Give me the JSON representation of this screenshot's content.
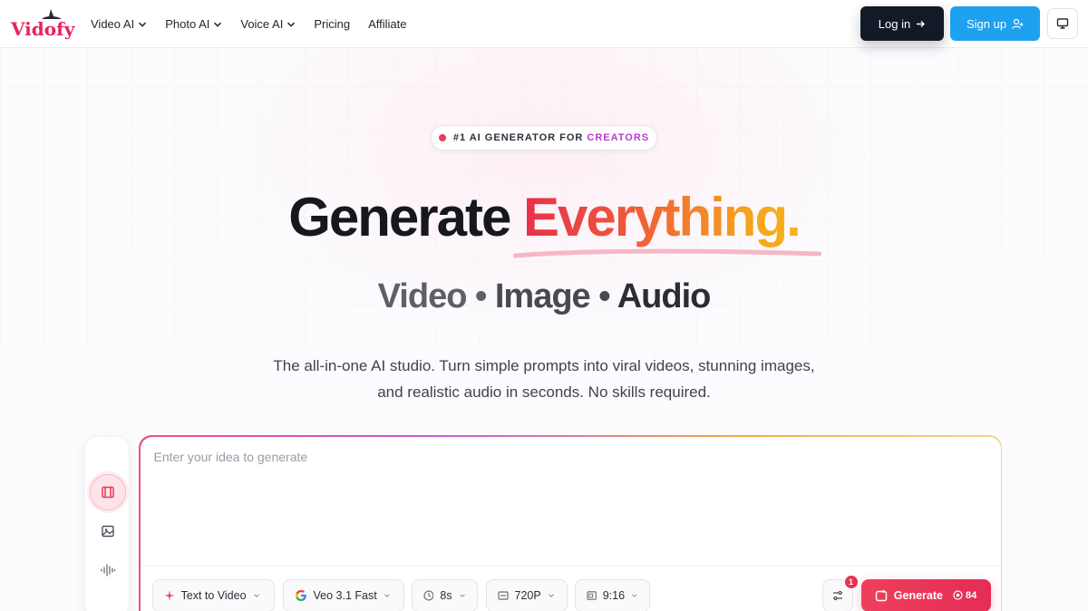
{
  "brand": {
    "name": "Vidofy"
  },
  "nav": {
    "items": [
      {
        "label": "Video AI",
        "dropdown": true
      },
      {
        "label": "Photo AI",
        "dropdown": true
      },
      {
        "label": "Voice AI",
        "dropdown": true
      },
      {
        "label": "Pricing",
        "dropdown": false
      },
      {
        "label": "Affiliate",
        "dropdown": false
      }
    ],
    "login_label": "Log in",
    "signup_label": "Sign up"
  },
  "hero": {
    "badge_text": "#1 AI GENERATOR FOR",
    "badge_accent": "CREATORS",
    "headline_part1": "Generate",
    "headline_part2": "Everything.",
    "subhead_1": "Video",
    "subhead_2": "Image",
    "subhead_3": "Audio",
    "subhead_sep": "•",
    "description": "The all-in-one AI studio. Turn simple prompts into viral videos, stunning images, and realistic audio in seconds. No skills required."
  },
  "prompt": {
    "placeholder": "Enter your idea to generate",
    "value": ""
  },
  "toolbar": {
    "mode_label": "Text to Video",
    "model_label": "Veo 3.1 Fast",
    "duration_label": "8s",
    "resolution_label": "720P",
    "ratio_label": "9:16",
    "settings_badge": "1",
    "generate_label": "Generate",
    "generate_cost": "84"
  },
  "colors": {
    "brand": "#e6245c",
    "login_bg": "#131926",
    "signup_bg": "#1ea1ef",
    "generate_bg": "#e8324e",
    "accent_purple": "#b63ad0"
  }
}
